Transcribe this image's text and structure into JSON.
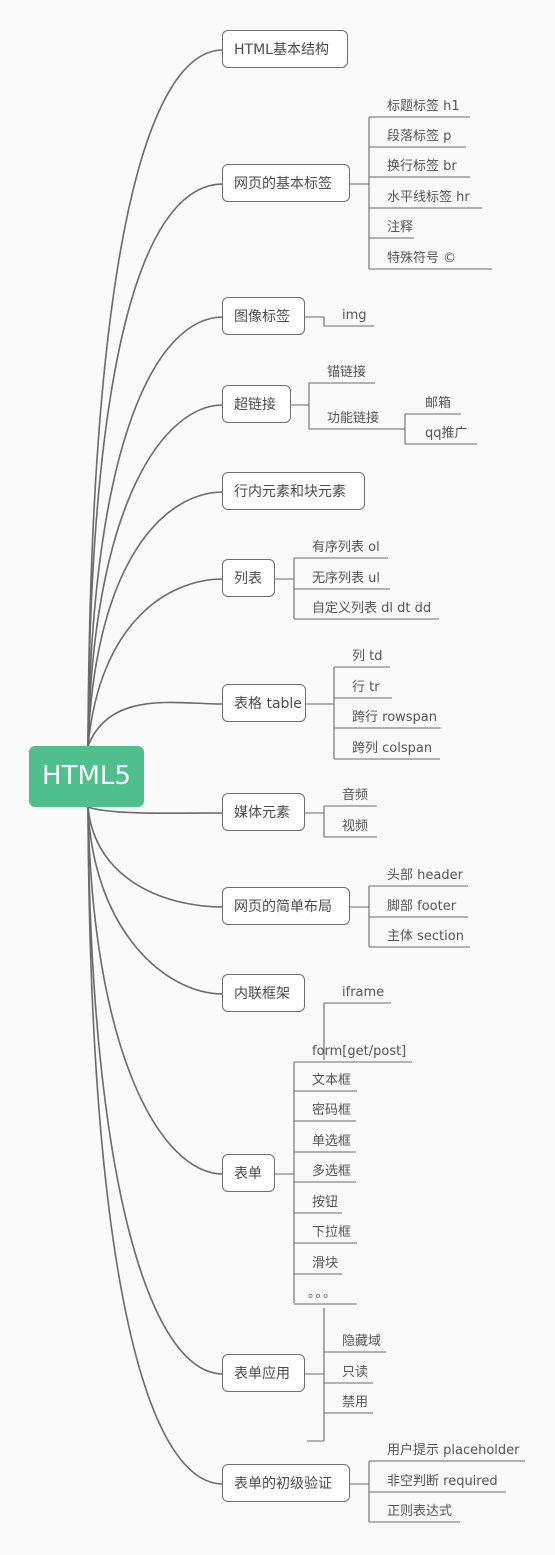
{
  "root": "HTML5",
  "branches": {
    "b1": "HTML基本结构",
    "b2": "网页的基本标签",
    "b3": "图像标签",
    "b4": "超链接",
    "b5": "行内元素和块元素",
    "b6": "列表",
    "b7": "表格 table",
    "b8": "媒体元素",
    "b9": "网页的简单布局",
    "b10": "内联框架",
    "b11": "表单",
    "b12": "表单应用",
    "b13": "表单的初级验证"
  },
  "leaves": {
    "basic_tags": [
      "标题标签  h1",
      "段落标签  p",
      "换行标签  br",
      "水平线标签  hr",
      "注释",
      "特殊符号 ©"
    ],
    "image": [
      "img"
    ],
    "hyperlink": [
      "锚链接",
      "功能链接"
    ],
    "function_link": [
      "邮箱",
      "qq推广"
    ],
    "list": [
      "有序列表 ol",
      "无序列表  ul",
      "自定义列表 dl dt dd"
    ],
    "table": [
      "列 td",
      "行  tr",
      "跨行 rowspan",
      "跨列 colspan"
    ],
    "media": [
      "音频",
      "视频"
    ],
    "layout": [
      "头部 header",
      "脚部  footer",
      "主体 section"
    ],
    "form": [
      "iframe",
      "form[get/post]",
      "文本框",
      "密码框",
      "单选框",
      "多选框",
      "按钮",
      "下拉框",
      "滑块",
      "。。。"
    ],
    "form_app": [
      "隐藏域",
      "只读",
      "禁用"
    ],
    "validation": [
      "用户提示 placeholder",
      "非空判断 required",
      "正则表达式"
    ]
  }
}
